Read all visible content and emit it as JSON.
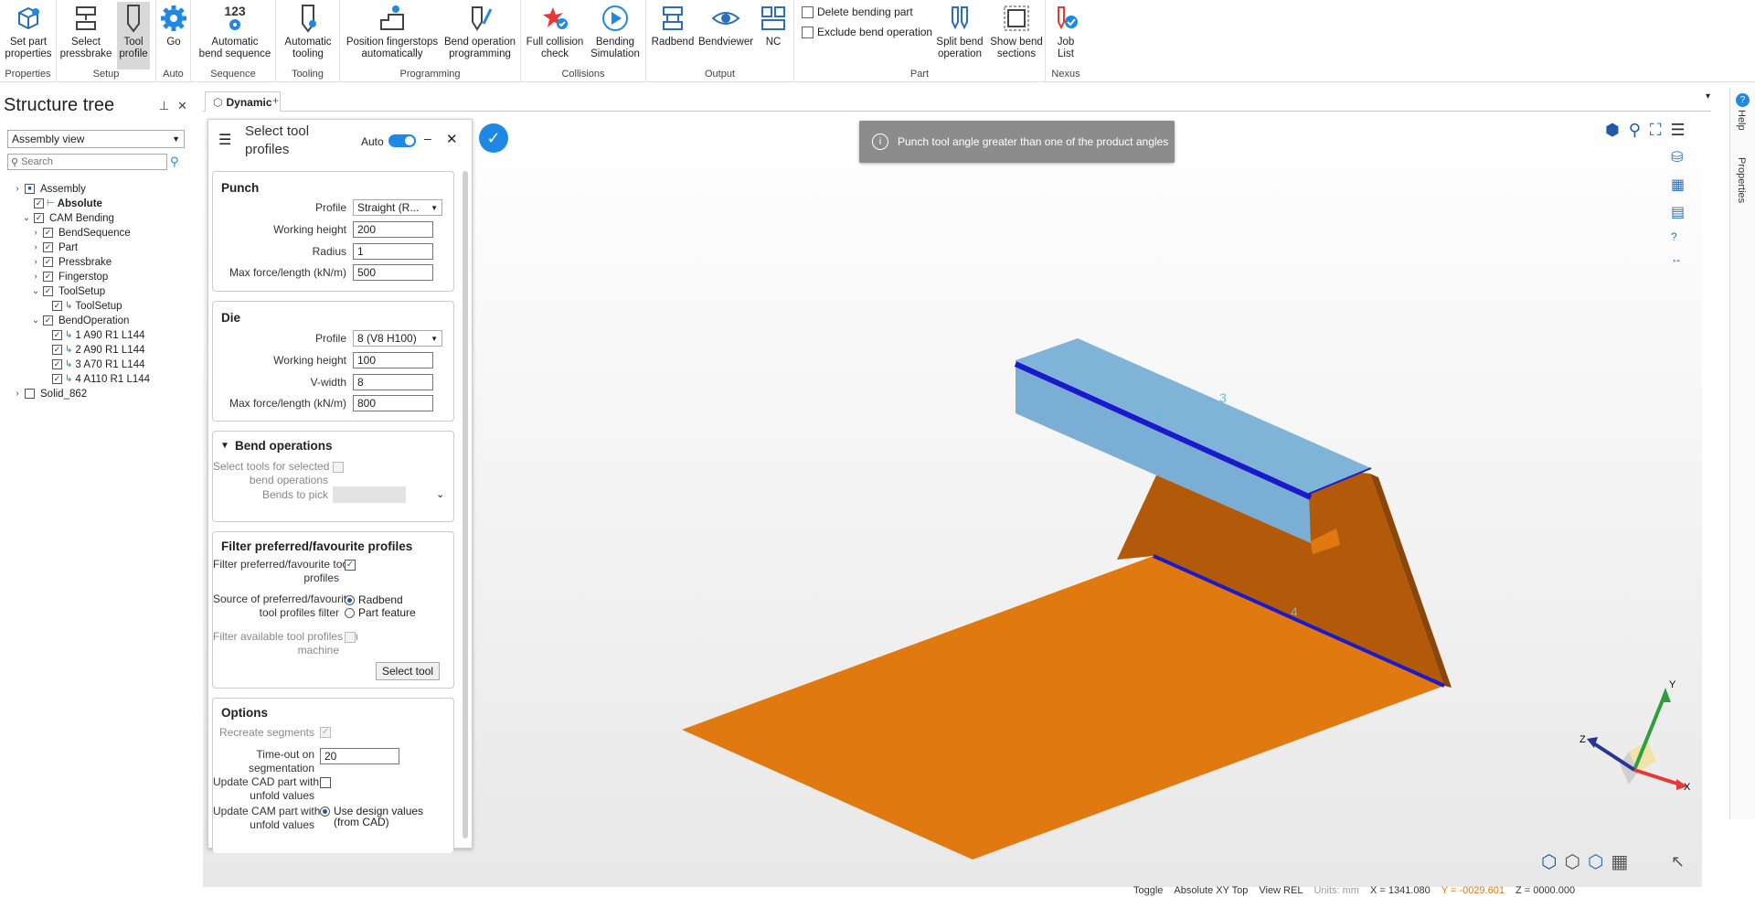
{
  "ribbon": {
    "groups": [
      {
        "label": "Properties",
        "buttons": [
          "Set part\nproperties"
        ]
      },
      {
        "label": "Setup",
        "buttons": [
          "Select\npressbrake",
          "Tool\nprofile"
        ]
      },
      {
        "label": "Auto",
        "buttons": [
          "Go"
        ]
      },
      {
        "label": "Sequence",
        "buttons": [
          "Automatic\nbend sequence"
        ]
      },
      {
        "label": "Tooling",
        "buttons": [
          "Automatic\ntooling"
        ]
      },
      {
        "label": "Programming",
        "buttons": [
          "Position fingerstops\nautomatically",
          "Bend operation\nprogramming"
        ]
      },
      {
        "label": "Collisions",
        "buttons": [
          "Full collision\ncheck",
          "Bending\nSimulation"
        ]
      },
      {
        "label": "Output",
        "buttons": [
          "Radbend",
          "Bendviewer",
          "NC"
        ]
      },
      {
        "label": "Part",
        "buttons": [
          "Delete bending part",
          "Exclude bend operation",
          "Split bend\noperation",
          "Show bend\nsections"
        ]
      },
      {
        "label": "Nexus",
        "buttons": [
          "Job\nList"
        ]
      }
    ],
    "seq_number": "123"
  },
  "structure": {
    "title": "Structure tree",
    "view": "Assembly view",
    "search_placeholder": "Search",
    "items": [
      {
        "label": "Assembly",
        "level": 0,
        "exp": ">",
        "cb": "minus",
        "bold": false
      },
      {
        "label": "Absolute",
        "level": 1,
        "exp": "",
        "cb": "check",
        "bold": true
      },
      {
        "label": "CAM Bending",
        "level": 1,
        "exp": "v",
        "cb": "check",
        "bold": false
      },
      {
        "label": "BendSequence",
        "level": 2,
        "exp": ">",
        "cb": "check",
        "bold": false
      },
      {
        "label": "Part",
        "level": 2,
        "exp": ">",
        "cb": "check",
        "bold": false
      },
      {
        "label": "Pressbrake",
        "level": 2,
        "exp": ">",
        "cb": "check",
        "bold": false
      },
      {
        "label": "Fingerstop",
        "level": 2,
        "exp": ">",
        "cb": "check",
        "bold": false
      },
      {
        "label": "ToolSetup",
        "level": 2,
        "exp": "v",
        "cb": "check",
        "bold": false
      },
      {
        "label": "ToolSetup",
        "level": 3,
        "exp": "",
        "cb": "check",
        "bold": false
      },
      {
        "label": "BendOperation",
        "level": 2,
        "exp": "v",
        "cb": "check",
        "bold": false
      },
      {
        "label": "1 A90 R1 L144",
        "level": 3,
        "exp": "",
        "cb": "check",
        "bold": false
      },
      {
        "label": "2 A90 R1 L144",
        "level": 3,
        "exp": "",
        "cb": "check",
        "bold": false
      },
      {
        "label": "3 A70 R1 L144",
        "level": 3,
        "exp": "",
        "cb": "check",
        "bold": false
      },
      {
        "label": "4 A110 R1 L144",
        "level": 3,
        "exp": "",
        "cb": "check",
        "bold": false
      },
      {
        "label": "Solid_862",
        "level": 0,
        "exp": ">",
        "cb": "empty",
        "bold": false
      }
    ]
  },
  "tabs": {
    "active": "Dynamic",
    "add": "+"
  },
  "dialog": {
    "title": "Select tool\nprofiles",
    "auto_label": "Auto",
    "punch": {
      "title": "Punch",
      "profile_label": "Profile",
      "profile": "Straight (R...",
      "wh_label": "Working height",
      "wh": "200",
      "radius_label": "Radius",
      "radius": "1",
      "mf_label": "Max force/length (kN/m)",
      "mf": "500"
    },
    "die": {
      "title": "Die",
      "profile_label": "Profile",
      "profile": "8 (V8 H100)",
      "wh_label": "Working height",
      "wh": "100",
      "vw_label": "V-width",
      "vw": "8",
      "mf_label": "Max force/length (kN/m)",
      "mf": "800"
    },
    "bendops": {
      "title": "Bend operations",
      "select_label": "Select tools for selected\nbend operations",
      "pick_label": "Bends to pick"
    },
    "filter": {
      "title": "Filter preferred/favourite profiles",
      "filter_label": "Filter preferred/favourite tool\nprofiles",
      "source_label": "Source of preferred/favourite\ntool profiles filter",
      "opt1": "Radbend",
      "opt2": "Part feature",
      "avail_label": "Filter available tool profiles on\nmachine",
      "select_tool": "Select tool"
    },
    "options": {
      "title": "Options",
      "recreate_label": "Recreate segments",
      "timeout_label": "Time-out on\nsegmentation",
      "timeout": "20",
      "update_cad_label": "Update CAD part with\nunfold values",
      "update_cam_label": "Update CAM part with\nunfold values",
      "design_values": "Use design values\n(from CAD)"
    }
  },
  "toast": {
    "message": "Punch tool angle greater than one of the product angles"
  },
  "model": {
    "labels": [
      "3",
      "2",
      "4"
    ]
  },
  "triad": {
    "x": "X",
    "y": "Y",
    "z": "Z"
  },
  "side": {
    "help": "Help",
    "properties": "Properties"
  },
  "status": {
    "items": [
      "Toggle",
      "Absolute XY Top",
      "View REL",
      "Units: mm",
      "X = 1341.080",
      "Y = -0029.601",
      "Z = 0000.000"
    ]
  },
  "colors": {
    "accent": "#1e88e5",
    "flange_top": "#7fb3d8",
    "body": "#e07a10",
    "body_dark": "#b35a0a",
    "edge": "#1a1acc",
    "toast": "#8c8c8c"
  }
}
